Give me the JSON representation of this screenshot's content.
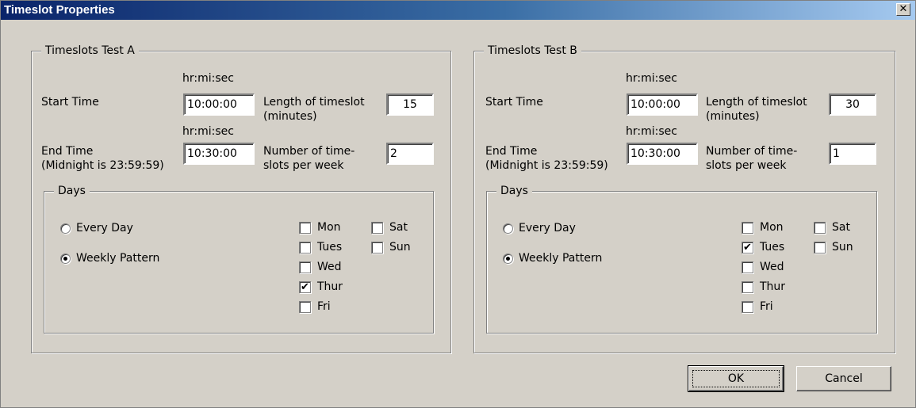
{
  "dialog": {
    "title": "Timeslot Properties",
    "close_glyph": "✕"
  },
  "labels": {
    "hr_fmt": "hr:mi:sec",
    "start_time": "Start Time",
    "end_time_line1": "End Time",
    "end_time_line2": "(Midnight is 23:59:59)",
    "length_line1": "Length of timeslot",
    "length_line2": "(minutes)",
    "number_line1": "Number of time-",
    "number_line2": "slots per week",
    "days": "Days",
    "every_day": "Every Day",
    "weekly_pattern": "Weekly Pattern",
    "mon": "Mon",
    "tues": "Tues",
    "wed": "Wed",
    "thur": "Thur",
    "fri": "Fri",
    "sat": "Sat",
    "sun": "Sun"
  },
  "groups": [
    {
      "title": "Timeslots Test A",
      "start_time": "10:00:00",
      "end_time": "10:30:00",
      "length": "15",
      "number": "2",
      "days_mode": "weekly",
      "checked": {
        "mon": false,
        "tues": false,
        "wed": false,
        "thur": true,
        "fri": false,
        "sat": false,
        "sun": false
      }
    },
    {
      "title": "Timeslots Test B",
      "start_time": "10:00:00",
      "end_time": "10:30:00",
      "length": "30",
      "number": "1",
      "days_mode": "weekly",
      "checked": {
        "mon": false,
        "tues": true,
        "wed": false,
        "thur": false,
        "fri": false,
        "sat": false,
        "sun": false
      }
    }
  ],
  "buttons": {
    "ok": "OK",
    "cancel": "Cancel"
  },
  "icons": {
    "check": "✔"
  }
}
